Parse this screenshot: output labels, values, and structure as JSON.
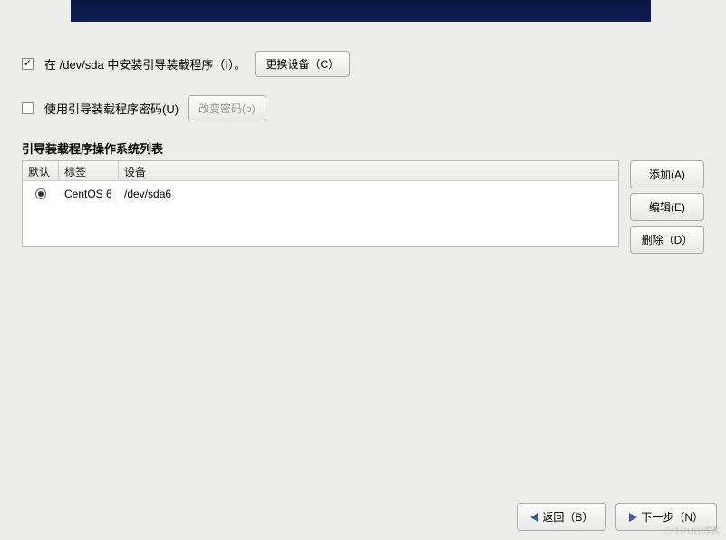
{
  "install_option": {
    "label": "在 /dev/sda 中安装引导装载程序（I）。",
    "change_device_btn": "更换设备（C）"
  },
  "password_option": {
    "label": "使用引导装载程序密码(U)",
    "change_password_btn": "改变密码(p)"
  },
  "table": {
    "title": "引导装载程序操作系统列表",
    "headers": {
      "default": "默认",
      "label": "标签",
      "device": "设备"
    },
    "rows": [
      {
        "selected": true,
        "label": "CentOS 6",
        "device": "/dev/sda6"
      }
    ]
  },
  "side_buttons": {
    "add": "添加(A)",
    "edit": "编辑(E)",
    "delete": "删除（D）"
  },
  "footer": {
    "back": "返回（B）",
    "next": "下一步（N）"
  },
  "watermark": "©ITPUB博客"
}
